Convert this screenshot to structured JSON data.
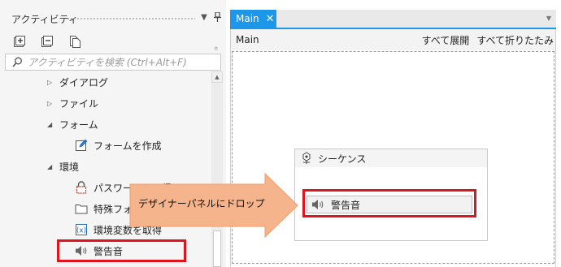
{
  "panel": {
    "title": "アクティビティ",
    "pin_icon": "pin-icon",
    "search_placeholder": "アクティビティを検索 (Ctrl+Alt+F)"
  },
  "tree": {
    "dialog": "ダイアログ",
    "file": "ファイル",
    "form": "フォーム",
    "create_form": "フォームを作成",
    "environment": "環境",
    "get_password": "パスワードを取得",
    "special_folder": "特殊フォル",
    "get_env_var": "環境変数を取得",
    "beep": "警告音"
  },
  "designer": {
    "tab_label": "Main",
    "breadcrumb": "Main",
    "expand_all": "すべて展開",
    "collapse_all": "すべて折りたたみ",
    "sequence_title": "シーケンス",
    "beep_activity": "警告音"
  },
  "callout": {
    "text": "デザイナーパネルにドロップ",
    "fill_color": "#f6b48c",
    "highlight_color": "#e0141e"
  },
  "colors": {
    "tab_accent": "#1c97ea"
  }
}
